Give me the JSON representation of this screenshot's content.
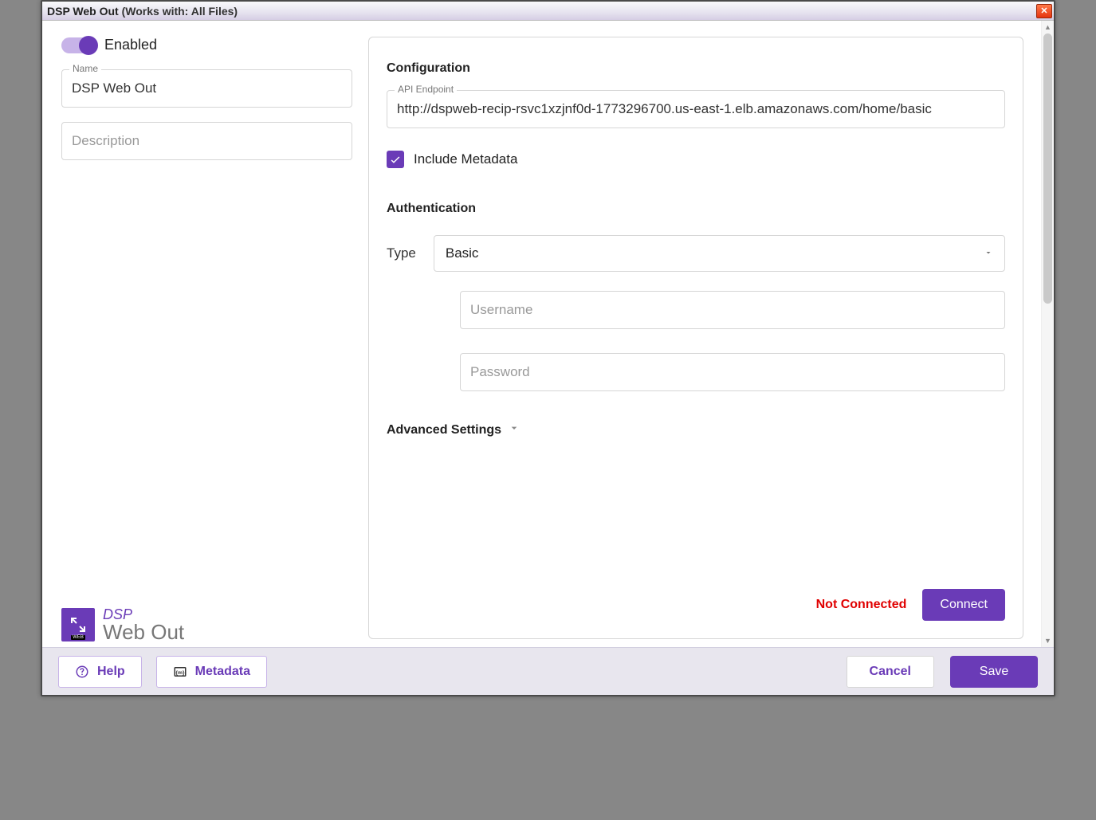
{
  "title": {
    "main": "DSP Web Out",
    "subtext": "  (Works with: All Files)"
  },
  "toggle": {
    "label": "Enabled",
    "on": true
  },
  "name": {
    "label": "Name",
    "value": "DSP Web Out"
  },
  "description": {
    "placeholder": "Description",
    "value": ""
  },
  "branding": {
    "l1": "DSP",
    "l2": "Web Out"
  },
  "config": {
    "sectionTitle": "Configuration",
    "apiEndpoint": {
      "label": "API Endpoint",
      "value": "http://dspweb-recip-rsvc1xzjnf0d-1773296700.us-east-1.elb.amazonaws.com/home/basic"
    },
    "includeMeta": {
      "label": "Include Metadata",
      "checked": true
    }
  },
  "auth": {
    "sectionTitle": "Authentication",
    "typeLabel": "Type",
    "typeValue": "Basic",
    "username": {
      "placeholder": "Username",
      "value": ""
    },
    "password": {
      "placeholder": "Password",
      "value": ""
    }
  },
  "advanced": {
    "label": "Advanced Settings"
  },
  "status": {
    "text": "Not Connected"
  },
  "buttons": {
    "connect": "Connect",
    "help": "Help",
    "metadata": "Metadata",
    "cancel": "Cancel",
    "save": "Save"
  }
}
